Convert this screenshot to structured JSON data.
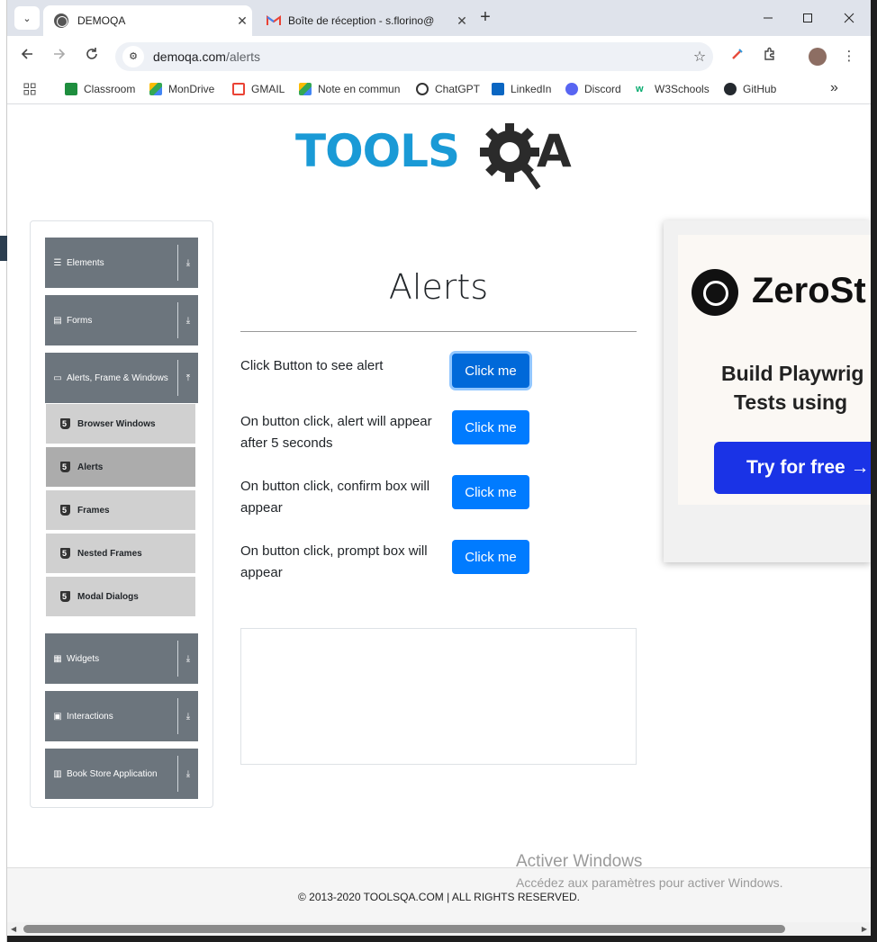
{
  "browser": {
    "tabs": [
      {
        "title": "DEMOQA",
        "active": true
      },
      {
        "title": "Boîte de réception - s.florino@",
        "active": false
      }
    ],
    "address": {
      "host": "demoqa.com",
      "path": "/alerts"
    },
    "bookmarks": [
      "Classroom",
      "MonDrive",
      "GMAIL",
      "Note en commun",
      "ChatGPT",
      "LinkedIn",
      "Discord",
      "W3Schools",
      "GitHub"
    ],
    "more_bookmarks": "»",
    "new_tab": "+",
    "tab_close": "✕",
    "menu_chevron": "⌄"
  },
  "page": {
    "title": "Alerts",
    "sidebar": {
      "groups": [
        {
          "label": "Elements",
          "icon": "list-icon"
        },
        {
          "label": "Forms",
          "icon": "form-icon"
        },
        {
          "label": "Alerts, Frame & Windows",
          "icon": "window-icon",
          "expanded": true
        },
        {
          "label": "Widgets",
          "icon": "grid-icon"
        },
        {
          "label": "Interactions",
          "icon": "interaction-icon"
        },
        {
          "label": "Book Store Application",
          "icon": "book-icon"
        }
      ],
      "sub_items": [
        "Browser Windows",
        "Alerts",
        "Frames",
        "Nested Frames",
        "Modal Dialogs"
      ],
      "active_sub_item": "Alerts"
    },
    "rows": [
      {
        "label": "Click Button to see alert",
        "button": "Click me"
      },
      {
        "label": "On button click, alert will appear after 5 seconds",
        "button": "Click me"
      },
      {
        "label": "On button click, confirm box will appear",
        "button": "Click me"
      },
      {
        "label": "On button click, prompt box will appear",
        "button": "Click me"
      }
    ],
    "ad": {
      "brand": "ZeroSt",
      "line1": "Build Playwrig",
      "line2": "Tests using",
      "cta": "Try for free →"
    },
    "footer": "© 2013-2020 TOOLSQA.COM | ALL RIGHTS RESERVED.",
    "watermark": {
      "title": "Activer Windows",
      "subtitle": "Accédez aux paramètres pour activer Windows."
    }
  },
  "colors": {
    "primary_button": "#007bff",
    "sidebar_group": "#6c757d",
    "sidebar_sub": "#d0d0d0",
    "sidebar_sub_active": "#acacac",
    "logo_blue": "#1a9ad6",
    "logo_dark": "#2b2b2b"
  }
}
